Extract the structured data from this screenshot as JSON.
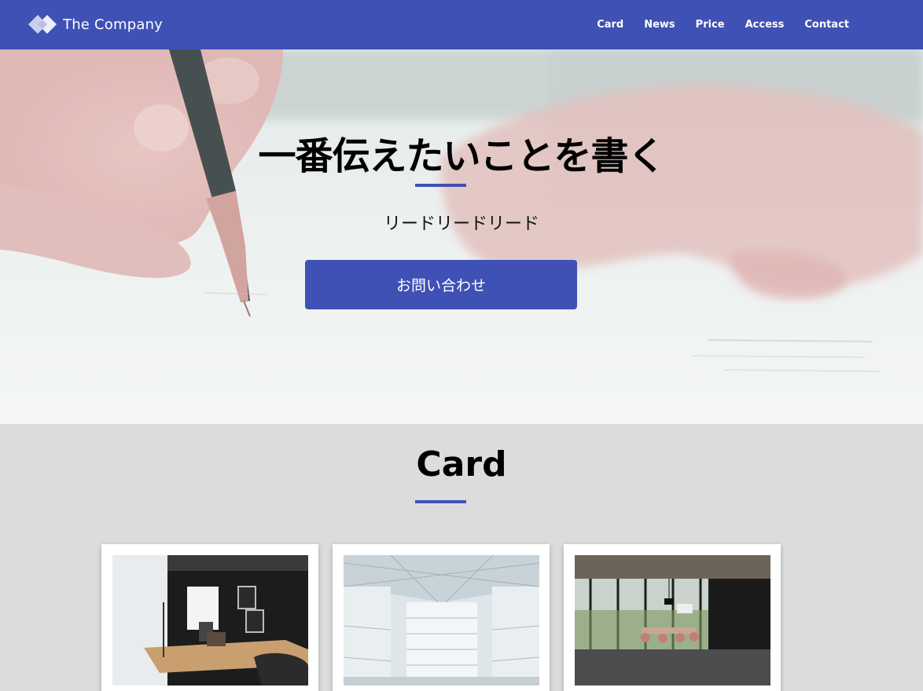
{
  "header": {
    "logo_text": "The Company",
    "nav": [
      "Card",
      "News",
      "Price",
      "Access",
      "Contact"
    ]
  },
  "hero": {
    "title": "一番伝えたいことを書く",
    "lead": "リードリードリード",
    "button_label": "お問い合わせ"
  },
  "card_section": {
    "title": "Card"
  },
  "colors": {
    "accent": "#3f51b5",
    "section_bg": "#dcdcdc",
    "card_bg": "#ffffff"
  }
}
